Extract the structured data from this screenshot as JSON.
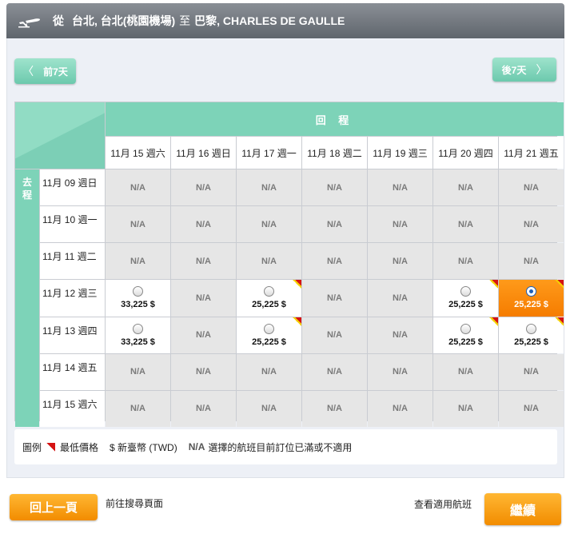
{
  "header": {
    "from_label": "從",
    "origin": "台北, 台北(桃園機場)",
    "to_label": "至",
    "destination": "巴黎, CHARLES DE GAULLE"
  },
  "nav": {
    "prev_label": "前7天",
    "next_label": "後7天"
  },
  "grid": {
    "return_header": "回 程",
    "outbound_header_line1": "去",
    "outbound_header_line2": "程",
    "return_dates": [
      "11月 15 週六",
      "11月 16 週日",
      "11月 17 週一",
      "11月 18 週二",
      "11月 19 週三",
      "11月 20 週四",
      "11月 21 週五"
    ],
    "departure_dates": [
      "11月 09 週日",
      "11月 10 週一",
      "11月 11 週二",
      "11月 12 週三",
      "11月 13 週四",
      "11月 14 週五",
      "11月 15 週六"
    ],
    "rows": [
      [
        "N/A",
        "N/A",
        "N/A",
        "N/A",
        "N/A",
        "N/A",
        "N/A"
      ],
      [
        "N/A",
        "N/A",
        "N/A",
        "N/A",
        "N/A",
        "N/A",
        "N/A"
      ],
      [
        "N/A",
        "N/A",
        "N/A",
        "N/A",
        "N/A",
        "N/A",
        "N/A"
      ],
      [
        {
          "price": "33,225 $",
          "lowest": false
        },
        "N/A",
        {
          "price": "25,225 $",
          "lowest": true
        },
        "N/A",
        "N/A",
        {
          "price": "25,225 $",
          "lowest": true
        },
        {
          "price": "25,225 $",
          "lowest": true,
          "selected": true
        }
      ],
      [
        {
          "price": "33,225 $",
          "lowest": false
        },
        "N/A",
        {
          "price": "25,225 $",
          "lowest": true
        },
        "N/A",
        "N/A",
        {
          "price": "25,225 $",
          "lowest": true
        },
        {
          "price": "25,225 $",
          "lowest": true
        }
      ],
      [
        "N/A",
        "N/A",
        "N/A",
        "N/A",
        "N/A",
        "N/A",
        "N/A"
      ],
      [
        "N/A",
        "N/A",
        "N/A",
        "N/A",
        "N/A",
        "N/A",
        "N/A"
      ]
    ]
  },
  "legend": {
    "title": "圖例",
    "lowest_label": "最低價格",
    "currency_label": "$ 新臺幣 (TWD)",
    "na_label": "N/A",
    "na_desc": "選擇的航班目前訂位已滿或不適用"
  },
  "actions": {
    "back_label": "回上一頁",
    "back_desc": "前往搜尋頁面",
    "view_flights_label": "查看適用航班",
    "continue_label": "繼續"
  },
  "colors": {
    "accent_green": "#7dd3b8",
    "selected_orange": "#f57c00",
    "lowest_flag_red": "#d51414"
  }
}
